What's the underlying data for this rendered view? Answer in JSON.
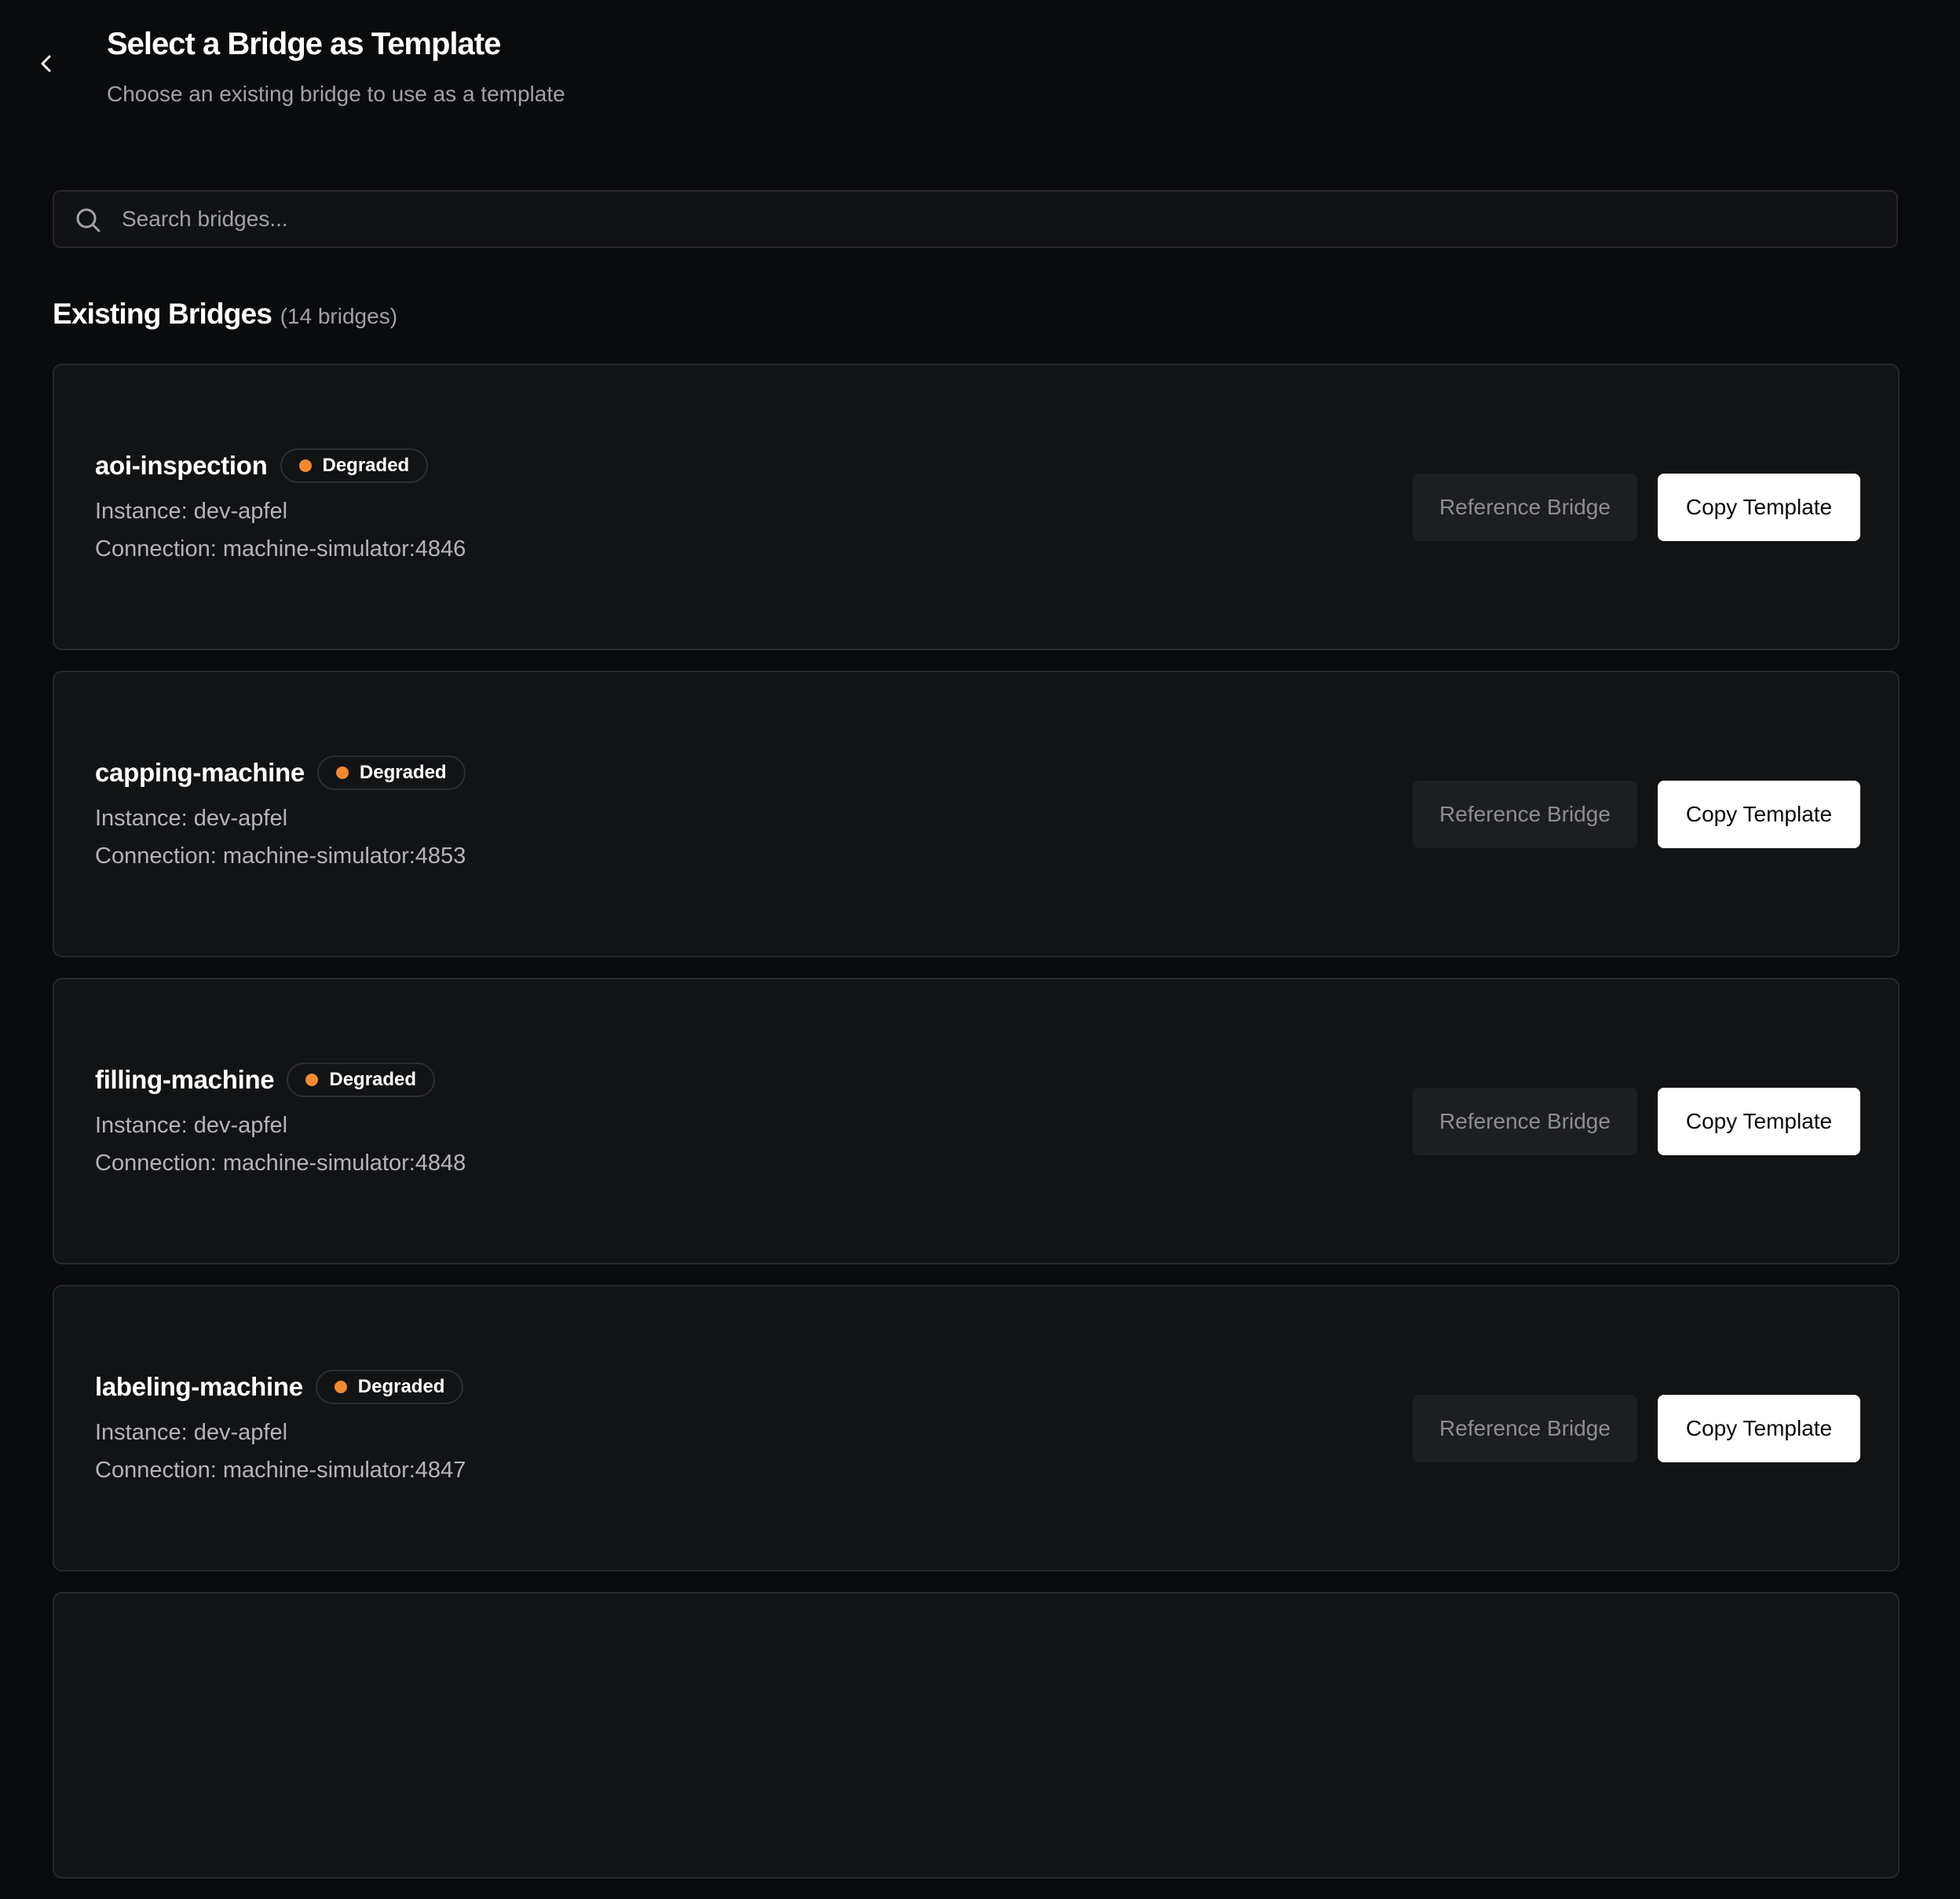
{
  "header": {
    "title": "Select a Bridge as Template",
    "subtitle": "Choose an existing bridge to use as a template",
    "back_icon": "chevron-left-icon"
  },
  "search": {
    "placeholder": "Search bridges...",
    "value": "",
    "icon": "search-icon"
  },
  "section": {
    "title": "Existing Bridges",
    "count": "(14 bridges)"
  },
  "colors": {
    "background": "#0a0b0d",
    "card": "#121315",
    "degraded": "#f28a2e",
    "primary_button": "#ffffff"
  },
  "bridges": [
    {
      "name": "aoi-inspection",
      "status": "Degraded",
      "instance": "Instance: dev-apfel",
      "connection": "Connection: machine-simulator:4846",
      "reference_label": "Reference Bridge",
      "copy_label": "Copy Template"
    },
    {
      "name": "capping-machine",
      "status": "Degraded",
      "instance": "Instance: dev-apfel",
      "connection": "Connection: machine-simulator:4853",
      "reference_label": "Reference Bridge",
      "copy_label": "Copy Template"
    },
    {
      "name": "filling-machine",
      "status": "Degraded",
      "instance": "Instance: dev-apfel",
      "connection": "Connection: machine-simulator:4848",
      "reference_label": "Reference Bridge",
      "copy_label": "Copy Template"
    },
    {
      "name": "labeling-machine",
      "status": "Degraded",
      "instance": "Instance: dev-apfel",
      "connection": "Connection: machine-simulator:4847",
      "reference_label": "Reference Bridge",
      "copy_label": "Copy Template"
    }
  ]
}
